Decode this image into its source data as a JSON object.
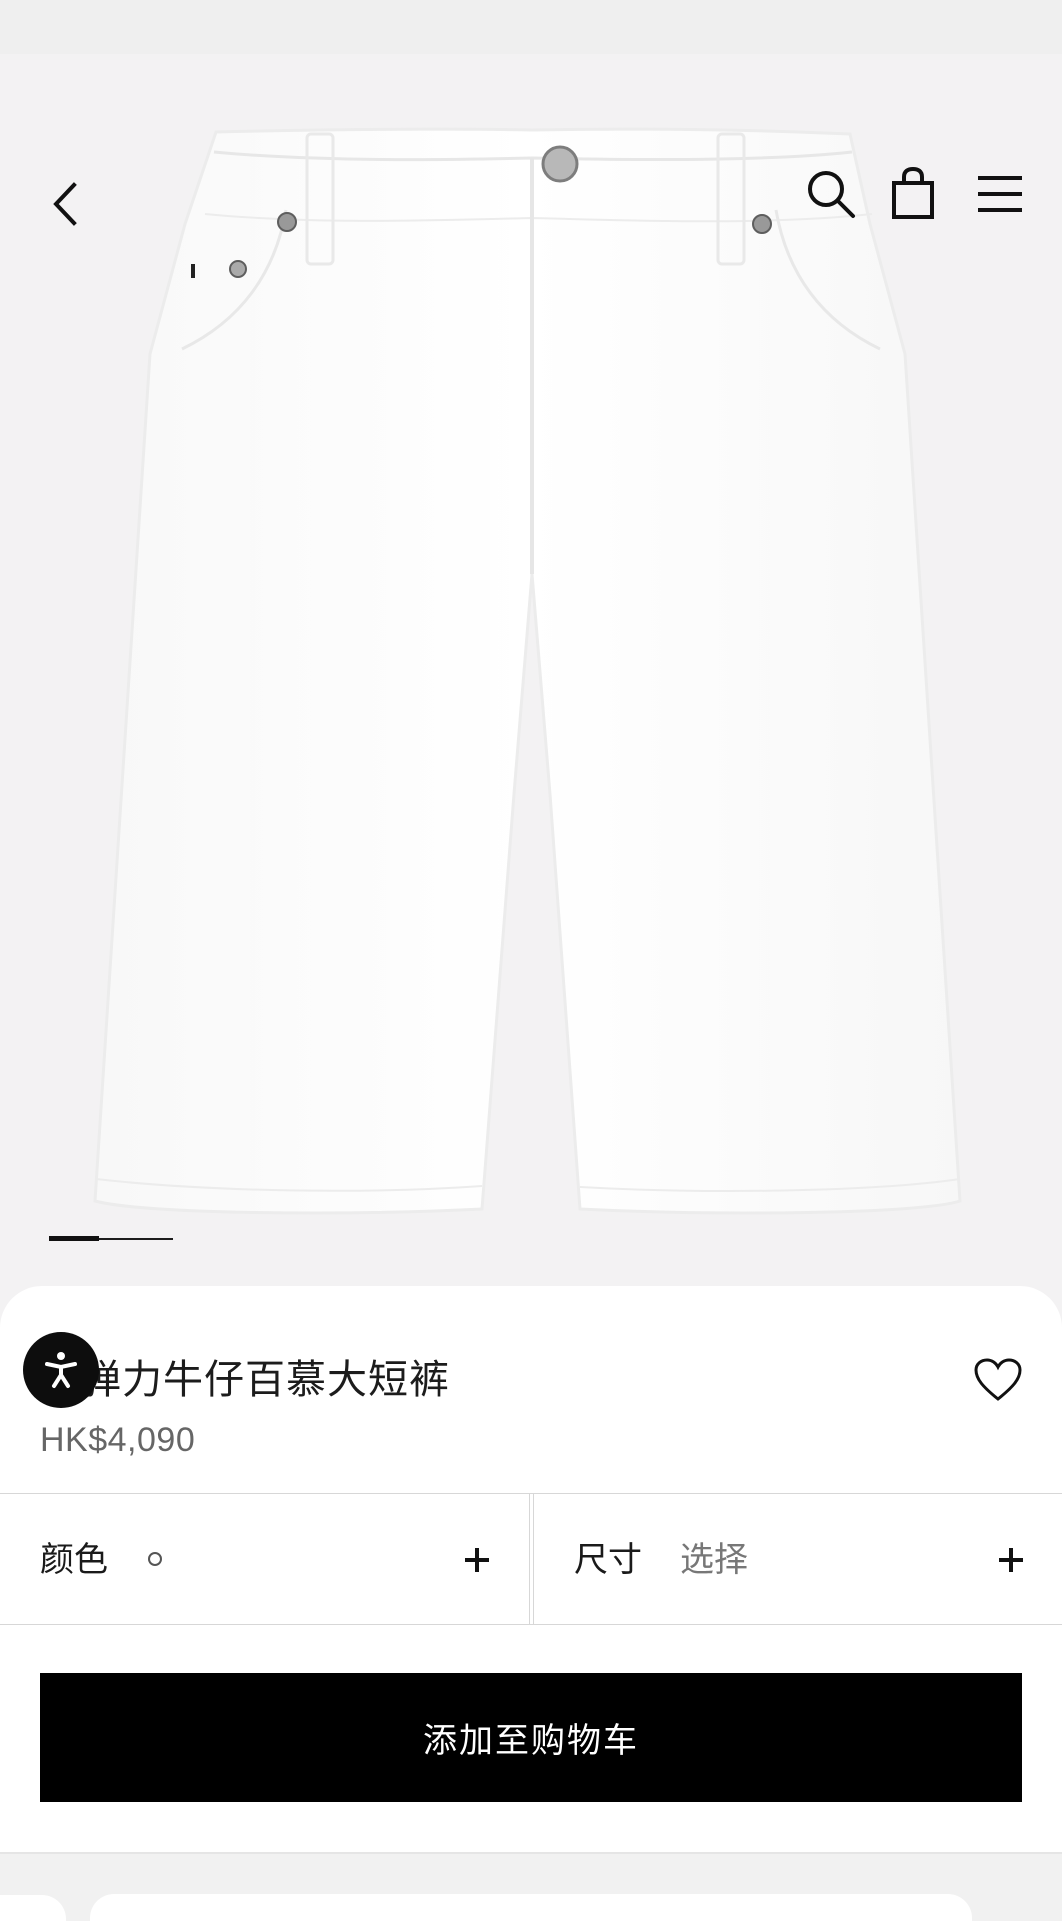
{
  "navigation": {
    "back_icon": "chevron-left-icon",
    "search_icon": "search-icon",
    "bag_icon": "shopping-bag-icon",
    "menu_icon": "hamburger-menu-icon"
  },
  "gallery": {
    "current_slide": 1,
    "total_slides": 2
  },
  "product": {
    "title": "色弹力牛仔百慕大短裤",
    "price": "HK$4,090",
    "wishlist_icon": "heart-icon"
  },
  "accessibility": {
    "icon": "accessibility-icon"
  },
  "selectors": {
    "color": {
      "label": "颜色",
      "selected_swatch": "white",
      "action_icon": "plus-icon"
    },
    "size": {
      "label": "尺寸",
      "value": "选择",
      "action_icon": "plus-icon"
    }
  },
  "cta": {
    "add_to_cart_label": "添加至购物车"
  },
  "colors": {
    "background": "#f3f2f3",
    "sheet": "#ffffff",
    "text_primary": "#1c1c1c",
    "text_secondary": "#666666",
    "button": "#000000",
    "border": "#d7d7d7"
  }
}
